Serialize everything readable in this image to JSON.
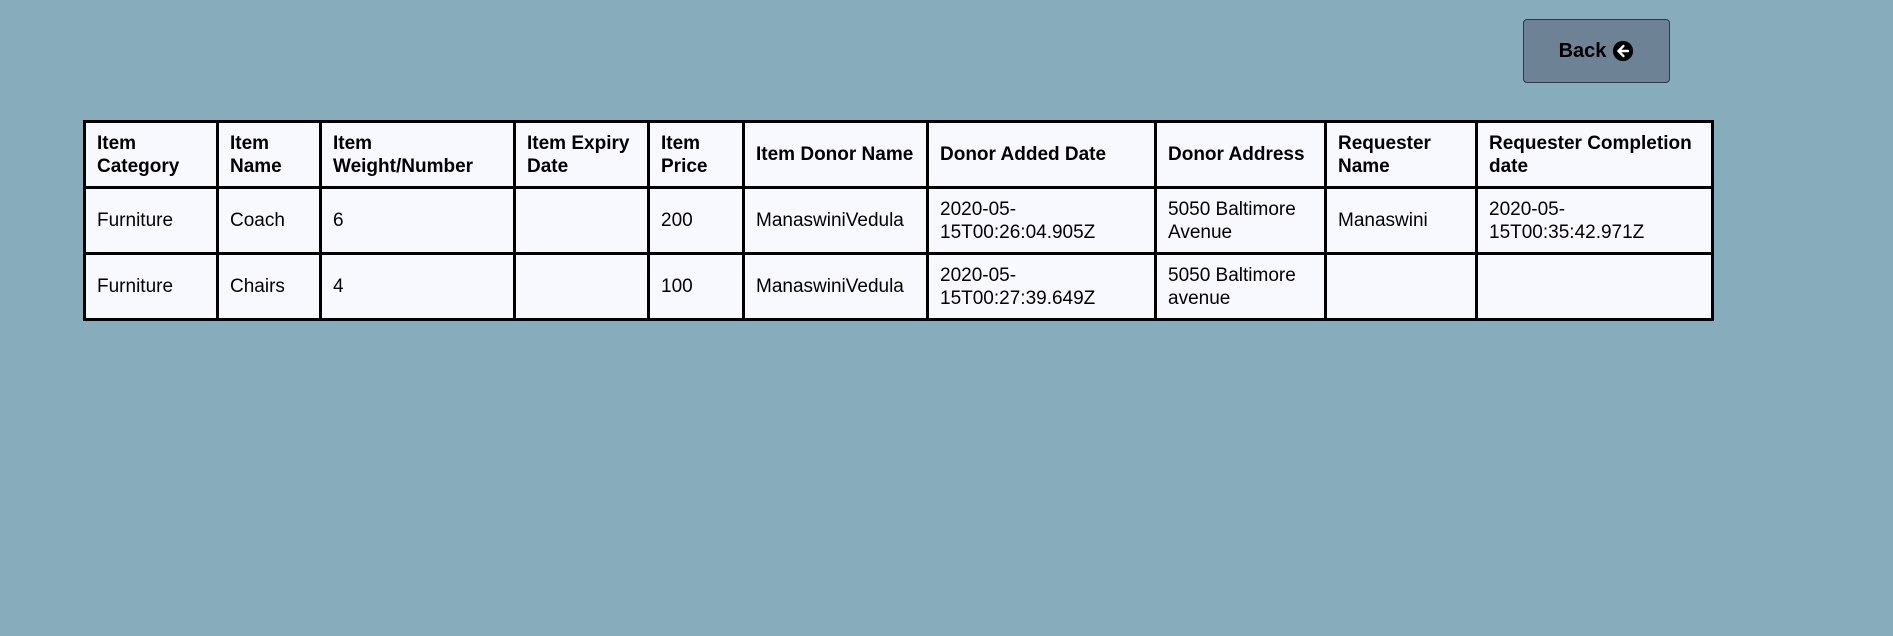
{
  "back_button": {
    "label": "Back",
    "icon": "arrow-circle-left-icon"
  },
  "table": {
    "columns": [
      "Item Category",
      "Item Name",
      "Item Weight/Number",
      "Item Expiry Date",
      "Item Price",
      "Item Donor Name",
      "Donor Added Date",
      "Donor Address",
      "Requester Name",
      "Requester Completion date"
    ],
    "rows": [
      [
        "Furniture",
        "Coach",
        "6",
        "",
        "200",
        "ManaswiniVedula",
        "2020-05-15T00:26:04.905Z",
        "5050 Baltimore Avenue",
        "Manaswini",
        "2020-05-15T00:35:42.971Z"
      ],
      [
        "Furniture",
        "Chairs",
        "4",
        "",
        "100",
        "ManaswiniVedula",
        "2020-05-15T00:27:39.649Z",
        "5050 Baltimore avenue",
        "",
        ""
      ]
    ]
  },
  "colors": {
    "background": "#87acbc",
    "button": "#6e8295",
    "table_background": "#f8f8ff",
    "border": "#000000"
  }
}
